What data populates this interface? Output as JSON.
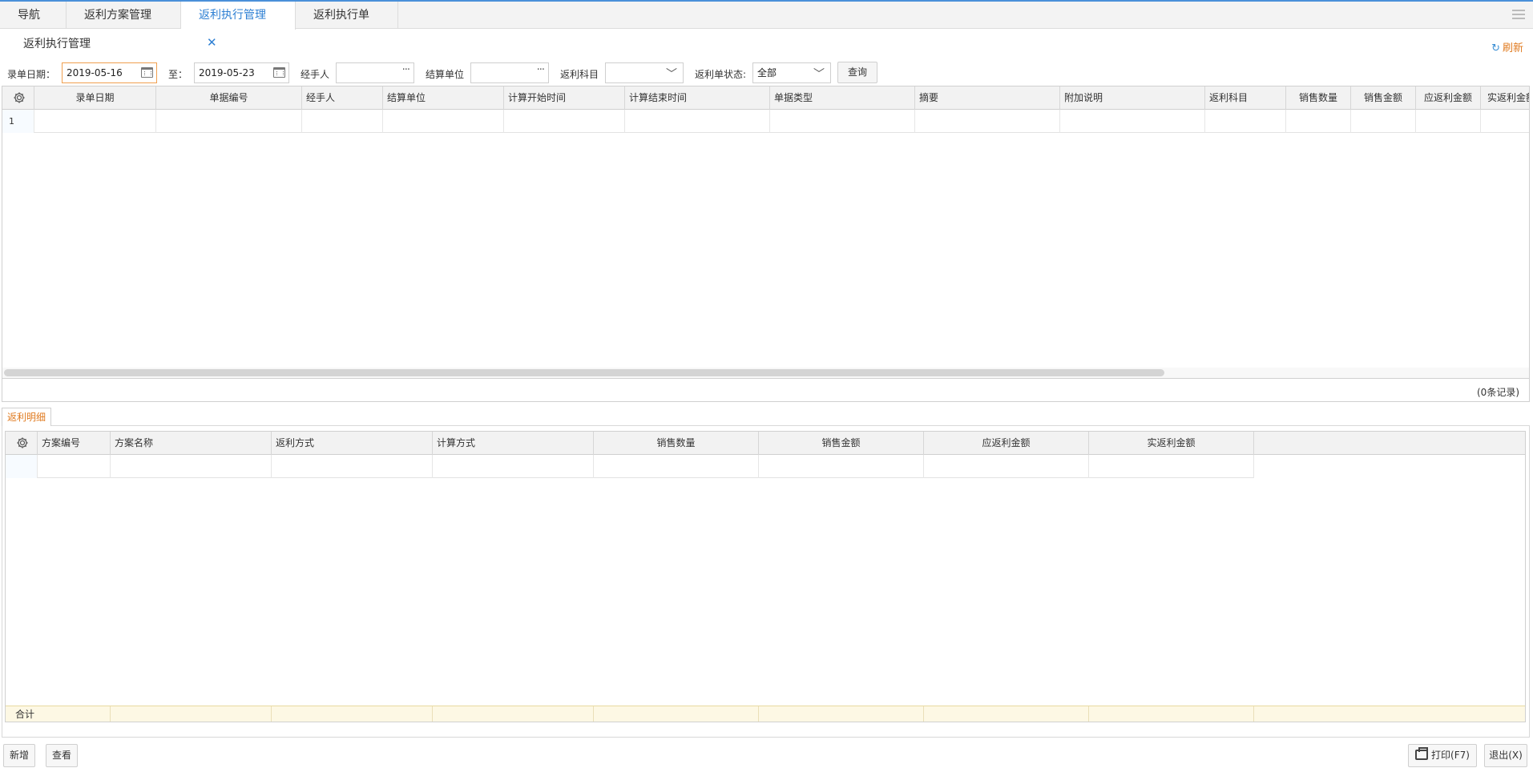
{
  "tabs": [
    {
      "label": "导航"
    },
    {
      "label": "返利方案管理"
    },
    {
      "label": "返利执行管理",
      "active": true
    },
    {
      "label": "返利执行单"
    }
  ],
  "page": {
    "title": "返利执行管理",
    "refresh_label": "刷新"
  },
  "filters": {
    "date_label": "录单日期：",
    "date_from": "2019-05-16",
    "to_label": "至：",
    "date_to": "2019-05-23",
    "handler_label": "经手人",
    "handler_value": "",
    "unit_label": "结算单位",
    "unit_value": "",
    "subject_label": "返利科目",
    "subject_value": "",
    "status_label": "返利单状态:",
    "status_value": "全部",
    "query_label": "查询"
  },
  "main_grid": {
    "columns": [
      "录单日期",
      "单据编号",
      "经手人",
      "结算单位",
      "计算开始时间",
      "计算结束时间",
      "单据类型",
      "摘要",
      "附加说明",
      "返利科目",
      "销售数量",
      "销售金额",
      "应返利金额",
      "实返利金额"
    ],
    "rows": [
      {
        "num": "1"
      }
    ],
    "record_count": "(0条记录)"
  },
  "detail": {
    "tab_label": "返利明细",
    "columns": [
      "方案编号",
      "方案名称",
      "返利方式",
      "计算方式",
      "销售数量",
      "销售金额",
      "应返利金额",
      "实返利金额"
    ],
    "sum_label": "合计"
  },
  "bottom": {
    "new_label": "新增",
    "view_label": "查看",
    "print_label": "打印(F7)",
    "exit_label": "退出(X)"
  },
  "colors": {
    "accent_blue": "#2d7fd3",
    "accent_orange": "#e07a1f",
    "sum_row_bg": "#fdf8e4"
  }
}
